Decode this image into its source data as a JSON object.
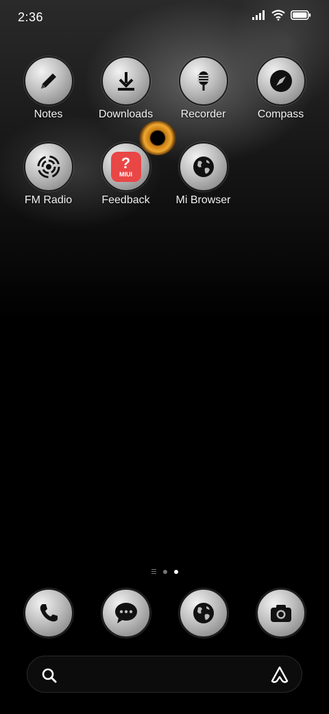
{
  "status_bar": {
    "time": "2:36",
    "icons": [
      "signal-icon",
      "wifi-icon",
      "battery-icon"
    ]
  },
  "apps": [
    {
      "label": "Notes",
      "icon": "pencil-icon"
    },
    {
      "label": "Downloads",
      "icon": "download-icon"
    },
    {
      "label": "Recorder",
      "icon": "microphone-icon"
    },
    {
      "label": "Compass",
      "icon": "compass-icon"
    },
    {
      "label": "FM Radio",
      "icon": "radio-icon"
    },
    {
      "label": "Feedback",
      "icon": "feedback-icon",
      "badge_symbol": "?",
      "badge_text": "MIUI"
    },
    {
      "label": "Mi Browser",
      "icon": "globe-icon"
    }
  ],
  "page_indicator": {
    "pages": 2,
    "current": 2
  },
  "dock": [
    {
      "icon": "phone-icon"
    },
    {
      "icon": "messages-icon"
    },
    {
      "icon": "globe-icon"
    },
    {
      "icon": "camera-icon"
    }
  ],
  "search": {
    "icons": [
      "search-icon",
      "assistant-icon"
    ]
  },
  "colors": {
    "background": "#000000",
    "icon_fill": "#bdbdbd",
    "feedback_red": "#e94646",
    "eye_orange": "#f0a830"
  }
}
